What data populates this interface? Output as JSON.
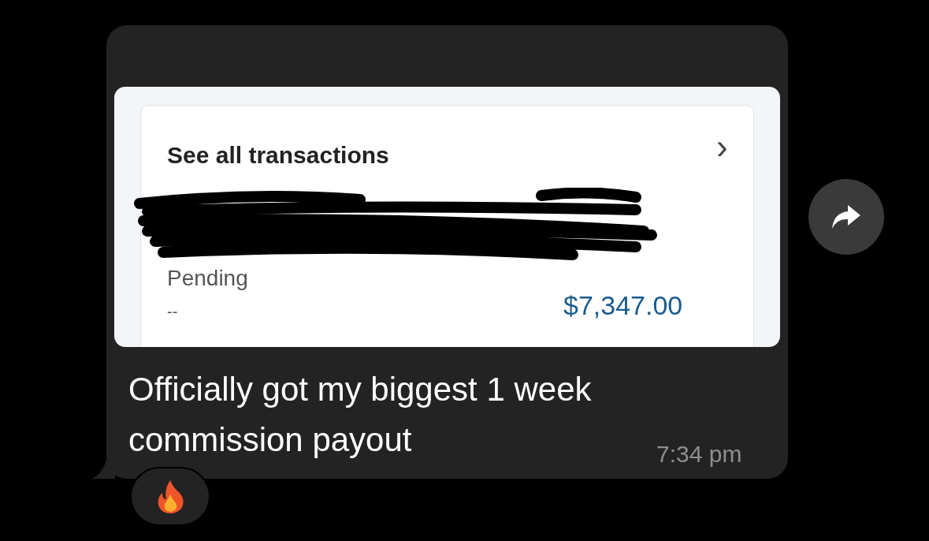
{
  "message": {
    "card": {
      "link": "See all transactions",
      "chevron": "›",
      "status": "Pending",
      "date": "--",
      "amount": "$7,347.00"
    },
    "text": "Officially got my biggest 1 week commission payout",
    "time": "7:34 pm",
    "reactions": [
      {
        "kind": "fire"
      }
    ]
  }
}
